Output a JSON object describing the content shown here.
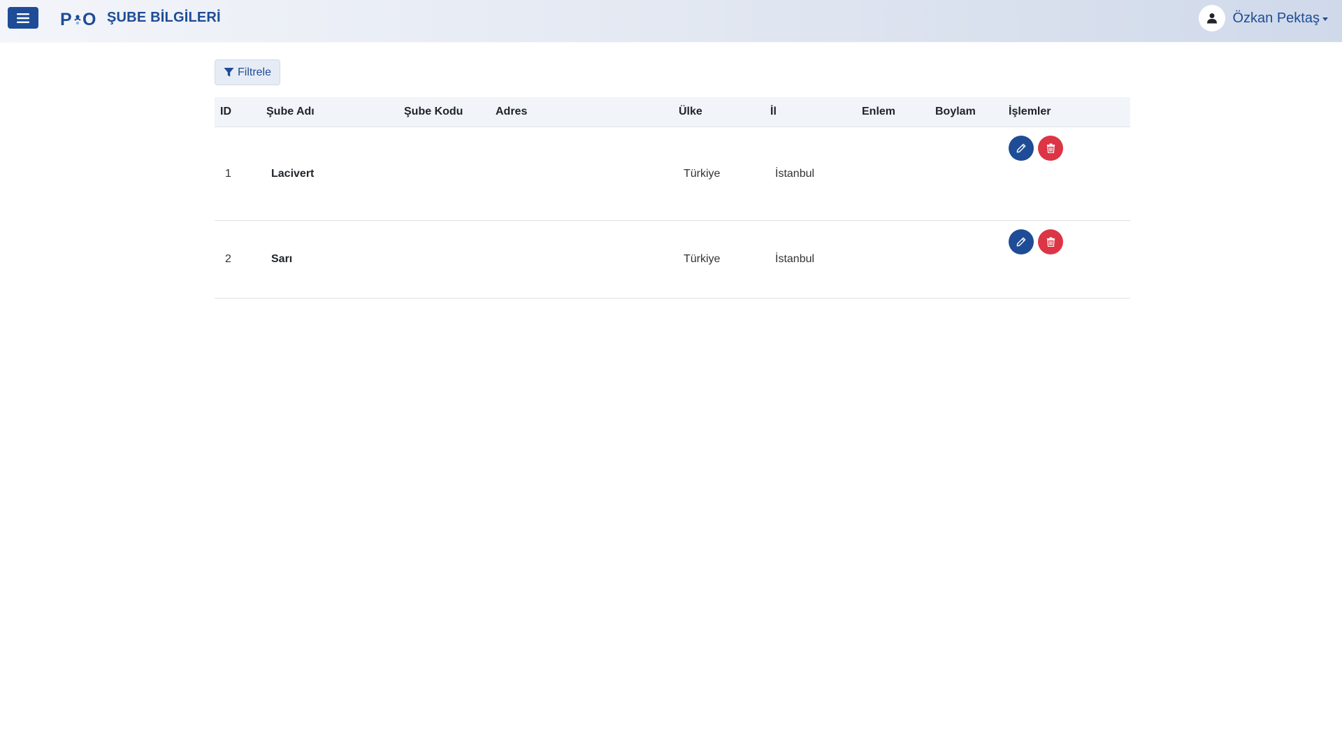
{
  "header": {
    "logo_text": "P O",
    "page_title": "ŞUBE BİLGİLERİ",
    "user_name": "Özkan Pektaş"
  },
  "toolbar": {
    "filter_label": "Filtrele"
  },
  "table": {
    "columns": [
      "ID",
      "Şube Adı",
      "Şube Kodu",
      "Adres",
      "Ülke",
      "İl",
      "Enlem",
      "Boylam",
      "İşlemler"
    ],
    "rows": [
      {
        "id": "1",
        "name": "Lacivert",
        "code": "",
        "address": "",
        "country": "Türkiye",
        "city": "İstanbul",
        "lat": "",
        "lng": ""
      },
      {
        "id": "2",
        "name": "Sarı",
        "code": "",
        "address": "",
        "country": "Türkiye",
        "city": "İstanbul",
        "lat": "",
        "lng": ""
      }
    ]
  },
  "icons": {
    "menu": "hamburger-icon",
    "user": "user-icon",
    "filter": "filter-icon",
    "edit": "pencil-icon",
    "delete": "trash-icon"
  },
  "colors": {
    "primary": "#1e4c96",
    "danger": "#dc3545"
  }
}
